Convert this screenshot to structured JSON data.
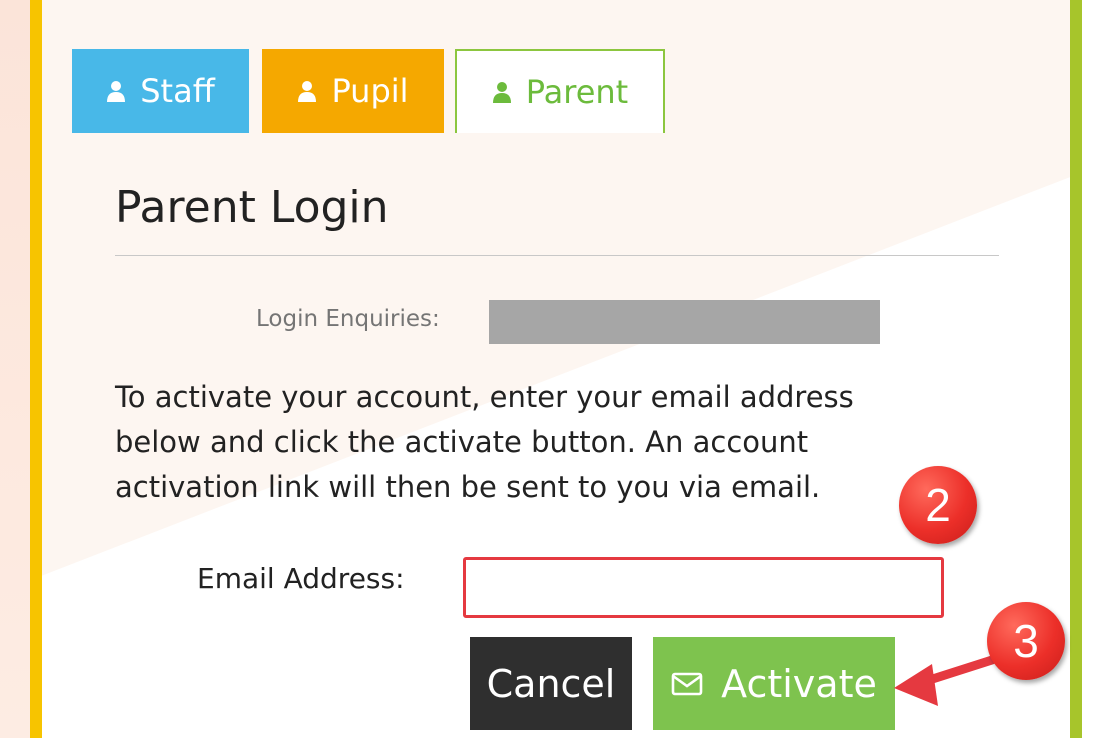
{
  "tabs": [
    {
      "label": "Staff",
      "color": "#48b8e8"
    },
    {
      "label": "Pupil",
      "color": "#f5a800"
    },
    {
      "label": "Parent",
      "color": "#6cbb3c"
    }
  ],
  "page_title": "Parent Login",
  "enquiries_label": "Login Enquiries:",
  "instructions": "To activate your account, enter your email address below and click the activate button. An account activation link will then be sent to you via email.",
  "email": {
    "label": "Email Address:",
    "value": "",
    "placeholder": ""
  },
  "buttons": {
    "cancel_label": "Cancel",
    "activate_label": "Activate"
  },
  "annotations": {
    "step_2": "2",
    "step_3": "3",
    "highlight_color": "#e53940"
  },
  "icons": {
    "tab_icon": "person-icon",
    "activate_icon": "envelope-icon"
  }
}
